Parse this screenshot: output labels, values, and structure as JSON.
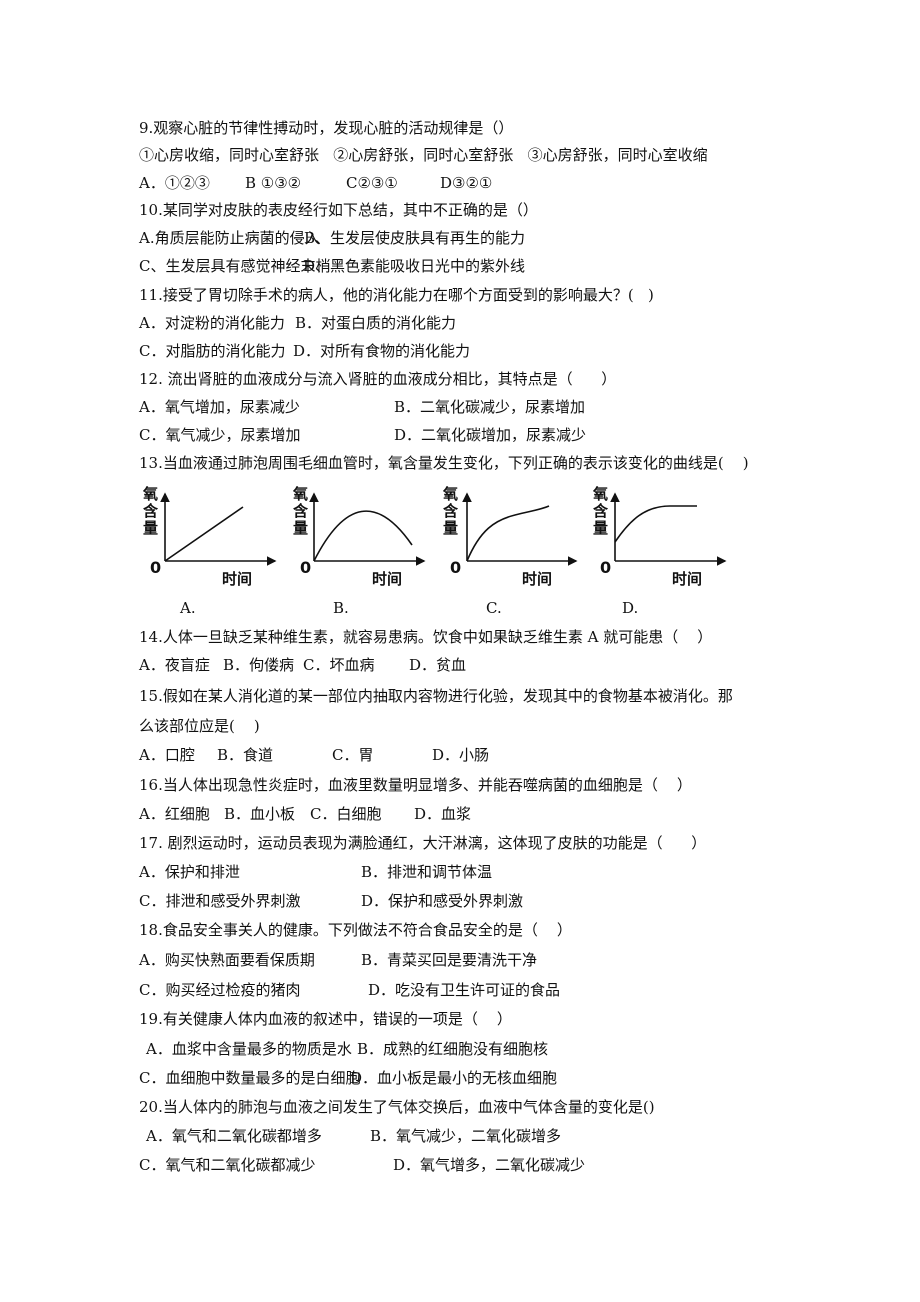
{
  "questions": [
    {
      "stem": "9.观察心脏的节律性搏动时，发现心脏的活动规律是（）",
      "sub": "①心房收缩，同时心室舒张   ②心房舒张，同时心室舒张   ③心房舒张，同时心室收缩",
      "options": [
        "A．①②③",
        "B ①③②",
        "C②③①",
        "D③②①"
      ]
    },
    {
      "stem": "10.某同学对皮肤的表皮经行如下总结，其中不正确的是（）",
      "options": [
        "A.角质层能防止病菌的侵入",
        "B、生发层使皮肤具有再生的能力",
        "C、生发层具有感觉神经末梢",
        "D、黑色素能吸收日光中的紫外线"
      ]
    },
    {
      "stem": "11.接受了胃切除手术的病人，他的消化能力在哪个方面受到的影响最大？(   )",
      "options": [
        "A．对淀粉的消化能力",
        "B．对蛋白质的消化能力",
        "C．对脂肪的消化能力",
        "D．对所有食物的消化能力"
      ]
    },
    {
      "stem": "12. 流出肾脏的血液成分与流入肾脏的血液成分相比，其特点是（      ）",
      "options": [
        "A．氧气增加，尿素减少",
        "B．二氧化碳减少，尿素增加",
        "C．氧气减少，尿素增加",
        "D．二氧化碳增加，尿素减少"
      ]
    },
    {
      "stem": "13.当血液通过肺泡周围毛细血管时，氧含量发生变化，下列正确的表示该变化的曲线是(    )",
      "graph_labels": {
        "y": "氧含量",
        "x": "时间",
        "origin": "0"
      },
      "options": [
        "A.",
        "B.",
        "C.",
        "D."
      ]
    },
    {
      "stem": "14.人体一旦缺乏某种维生素，就容易患病。饮食中如果缺乏维生素 A 就可能患（    ）",
      "options": [
        "A．夜盲症",
        "B．佝偻病",
        "C．坏血病",
        "D．贫血"
      ]
    },
    {
      "stem": "15.假如在某人消化道的某一部位内抽取内容物进行化验，发现其中的食物基本被消化。那",
      "stem2": "么该部位应是(    )",
      "options": [
        "A．口腔",
        "B．食道",
        "C．胃",
        "D．小肠"
      ]
    },
    {
      "stem": "16.当人体出现急性炎症时，血液里数量明显增多、并能吞噬病菌的血细胞是（    ）",
      "options": [
        "A．红细胞",
        "B．血小板",
        "C．白细胞",
        "D．血浆"
      ]
    },
    {
      "stem": "17. 剧烈运动时，运动员表现为满脸通红，大汗淋漓，这体现了皮肤的功能是（      ）",
      "options": [
        "A．保护和排泄",
        "B．排泄和调节体温",
        "C．排泄和感受外界刺激",
        "D．保护和感受外界刺激"
      ]
    },
    {
      "stem": "18.食品安全事关人的健康。下列做法不符合食品安全的是（    ）",
      "options": [
        "A．购买快熟面要看保质期",
        "B．青菜买回是要清洗干净",
        "C．购买经过检疫的猪肉",
        "D．吃没有卫生许可证的食品"
      ]
    },
    {
      "stem": "19.有关健康人体内血液的叙述中，错误的一项是（    ）",
      "options": [
        "A．血浆中含量最多的物质是水",
        "B．成熟的红细胞没有细胞核",
        "C．血细胞中数量最多的是白细胞",
        "D．血小板是最小的无核血细胞"
      ]
    },
    {
      "stem": "20.当人体内的肺泡与血液之间发生了气体交换后，血液中气体含量的变化是()",
      "options": [
        "A．氧气和二氧化碳都增多",
        "B．氧气减少，二氧化碳增多",
        "C．氧气和二氧化碳都减少",
        "D．氧气增多，二氧化碳减少"
      ]
    }
  ]
}
